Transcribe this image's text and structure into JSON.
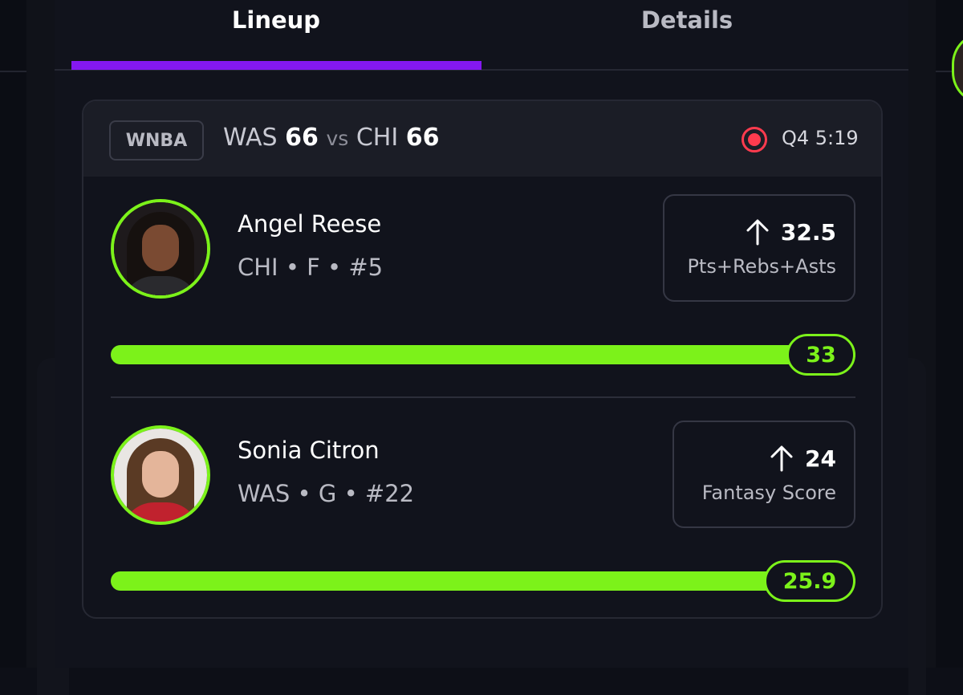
{
  "tabs": {
    "lineup": "Lineup",
    "details": "Details",
    "active": "lineup"
  },
  "game": {
    "league": "WNBA",
    "away_team": "WAS",
    "away_score": "66",
    "vs": "vs",
    "home_team": "CHI",
    "home_score": "66",
    "status_icon": "live-record-icon",
    "clock": "Q4 5:19"
  },
  "players": [
    {
      "name": "Angel Reese",
      "meta": "CHI • F • #5",
      "direction": "up",
      "line": "32.5",
      "stat_label": "Pts+Rebs+Asts",
      "result": "33",
      "progress_fraction": 1.0
    },
    {
      "name": "Sonia Citron",
      "meta": "WAS • G • #22",
      "direction": "up",
      "line": "24",
      "stat_label": "Fantasy Score",
      "result": "25.9",
      "progress_fraction": 1.0
    }
  ],
  "colors": {
    "accent_green": "#7cf21a",
    "tab_indicator": "#8418f0",
    "live_red": "#ff3b4e",
    "background": "#11131c"
  }
}
